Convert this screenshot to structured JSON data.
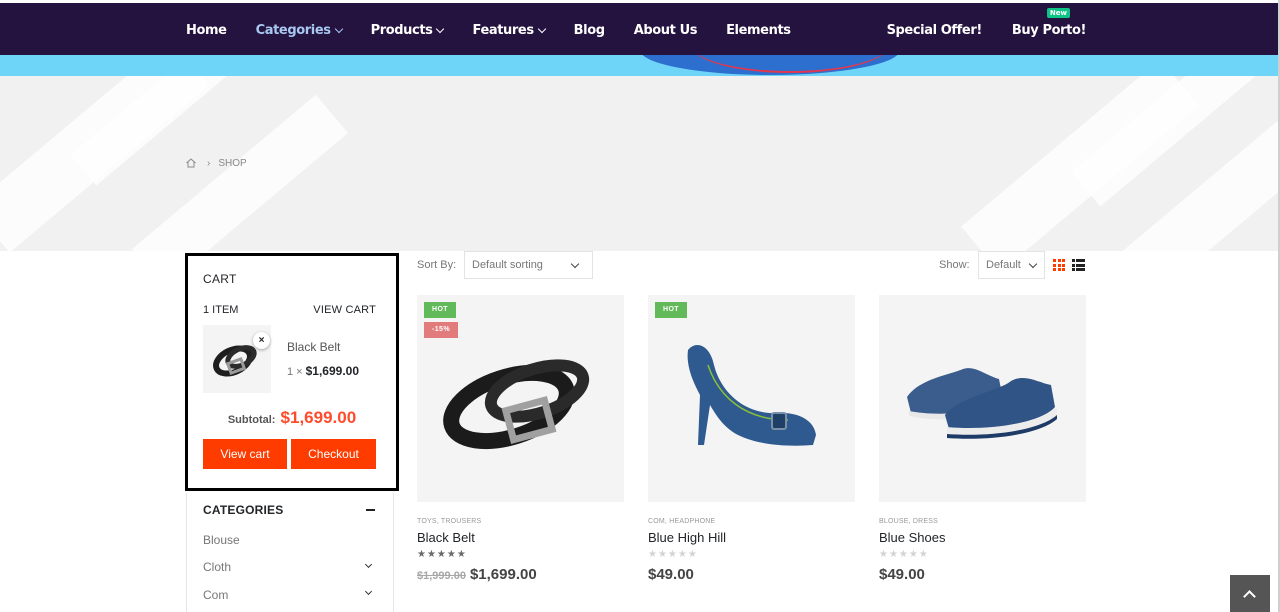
{
  "nav": {
    "items": [
      {
        "label": "Home",
        "dropdown": false,
        "active": false
      },
      {
        "label": "Categories",
        "dropdown": true,
        "active": true
      },
      {
        "label": "Products",
        "dropdown": true,
        "active": false
      },
      {
        "label": "Features",
        "dropdown": true,
        "active": false
      },
      {
        "label": "Blog",
        "dropdown": false,
        "active": false
      },
      {
        "label": "About Us",
        "dropdown": false,
        "active": false
      },
      {
        "label": "Elements",
        "dropdown": false,
        "active": false
      }
    ],
    "special_offer": "Special Offer!",
    "buy_porto": "Buy Porto!",
    "new_badge": "New",
    "bg_color": "#24123f",
    "active_color": "#a8c8f0"
  },
  "breadcrumb": {
    "home_icon": "home-icon",
    "current": "SHOP"
  },
  "cart": {
    "title": "CART",
    "count": "1 ITEM",
    "view_cart_link": "VIEW CART",
    "item": {
      "name": "Black Belt",
      "qty": "1 ×",
      "price": "$1,699.00",
      "remove": "×"
    },
    "subtotal_label": "Subtotal:",
    "subtotal_value": "$1,699.00",
    "view_cart_button": "View cart",
    "checkout_button": "Checkout",
    "accent_color": "#ff3c00"
  },
  "categories": {
    "title": "CATEGORIES",
    "items": [
      {
        "label": "Blouse",
        "expandable": false
      },
      {
        "label": "Cloth",
        "expandable": true
      },
      {
        "label": "Com",
        "expandable": true
      }
    ]
  },
  "toolbar": {
    "sort_label": "Sort By:",
    "sort_value": "Default sorting",
    "show_label": "Show:",
    "show_value": "Default",
    "view_icons": [
      "grid-icon",
      "list-icon"
    ]
  },
  "products": [
    {
      "name": "Black Belt",
      "categories": "TOYS, TROUSERS",
      "badges": [
        "HOT",
        "-15%"
      ],
      "old_price": "$1,999.00",
      "price": "$1,699.00",
      "rating": 5
    },
    {
      "name": "Blue High Hill",
      "categories": "COM, HEADPHONE",
      "badges": [
        "HOT"
      ],
      "old_price": "",
      "price": "$49.00",
      "rating": 0
    },
    {
      "name": "Blue Shoes",
      "categories": "BLOUSE, DRESS",
      "badges": [],
      "old_price": "",
      "price": "$49.00",
      "rating": 0
    }
  ],
  "scroll_top_icon": "chevron-up-icon"
}
